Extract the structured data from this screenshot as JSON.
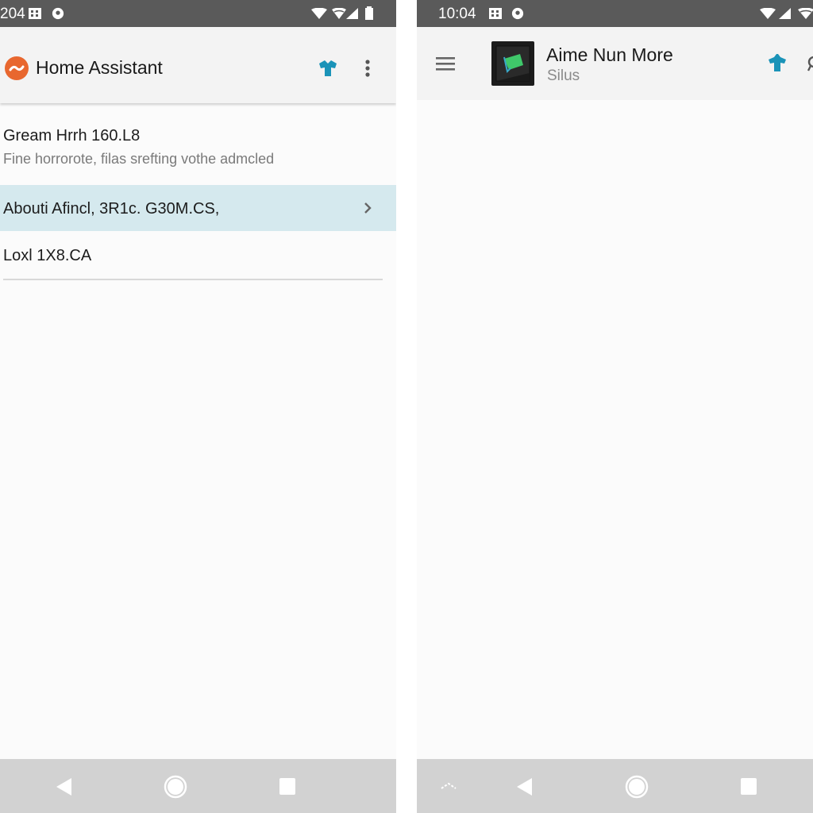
{
  "left_screen": {
    "status_bar": {
      "time": "204",
      "left_icons": [
        "notification-grid-icon",
        "location-pin-icon"
      ],
      "right_icons": [
        "wifi-icon",
        "wifi-icon",
        "cell-signal-icon",
        "battery-icon"
      ]
    },
    "app_bar": {
      "logo_icon": "home-assistant-logo-icon",
      "title": "Home Assistant",
      "actions": [
        "accent-action-icon",
        "more-vert-icon"
      ]
    },
    "list": [
      {
        "primary": "Gream Hrrh 160.L8",
        "secondary": "Fine horrorote, filas srefting vothe admcled",
        "selected": false
      },
      {
        "primary": "Abouti Afincl, 3R1c. G30M.CS,",
        "trailing_icon": "chevron-right-icon",
        "selected": true
      },
      {
        "primary": "Loxl 1X8.CA",
        "selected": false
      }
    ],
    "nav_bar": [
      "back-icon",
      "home-icon",
      "recents-icon"
    ]
  },
  "right_screen": {
    "status_bar": {
      "time": "10:04",
      "left_icons": [
        "notification-grid-icon",
        "location-pin-icon"
      ],
      "right_icons": [
        "wifi-icon",
        "cell-signal-icon",
        "wifi-icon"
      ]
    },
    "app_bar": {
      "nav_icon": "menu-icon",
      "thumbnail_icon": "app-thumbnail-icon",
      "title": "Aime Nun More",
      "subtitle": "Silus",
      "actions": [
        "accent-action-icon",
        "search-icon"
      ]
    },
    "nav_bar": [
      "keyboard-hide-icon",
      "back-icon",
      "home-icon",
      "recents-icon"
    ]
  },
  "colors": {
    "status_bar": "#5a5a5a",
    "app_bar": "#f3f3f3",
    "accent": "#1a93b8",
    "logo": "#e8672f",
    "selected_row": "#d5e9ee",
    "nav_bar": "#d2d2d2"
  }
}
